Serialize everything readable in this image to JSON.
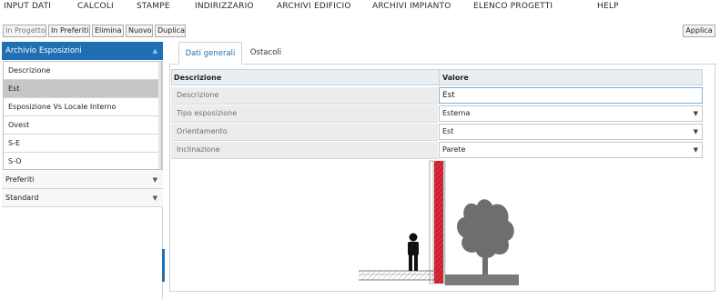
{
  "menu": [
    "INPUT DATI",
    "CALCOLI",
    "STAMPE",
    "INDIRIZZARIO",
    "ARCHIVI EDIFICIO",
    "ARCHIVI IMPIANTO",
    "ELENCO PROGETTI",
    "HELP"
  ],
  "toolbar": {
    "in_progetto": "In Progetto",
    "in_preferiti": "In Preferiti",
    "elimina": "Elimina",
    "nuovo": "Nuovo",
    "duplica": "Duplica",
    "applica": "Applica"
  },
  "sidebar": {
    "header": "Archivio Esposizioni",
    "items": [
      "Descrizione",
      "Est",
      "Esposizione Vs Locale Interno",
      "Ovest",
      "S-E",
      "S-O"
    ],
    "selected": "Est",
    "preferiti": "Preferiti",
    "standard": "Standard"
  },
  "tabs": [
    "Dati generali",
    "Ostacoli"
  ],
  "active_tab": "Dati generali",
  "grid": {
    "headers": [
      "Descrizione",
      "Valore"
    ],
    "rows": [
      {
        "label": "Descrizione",
        "value": "Est"
      },
      {
        "label": "Tipo esposizione",
        "value": "Esterna"
      },
      {
        "label": "Orientamento",
        "value": "Est"
      },
      {
        "label": "Inclinazione",
        "value": "Parete"
      }
    ]
  },
  "colors": {
    "accent": "#1f6fb4",
    "wall": "#e0283a",
    "silhouette": "#6e6e6e"
  },
  "icons": [
    "chevron-down-icon",
    "person-icon",
    "tree-icon",
    "wall-section-icon"
  ]
}
